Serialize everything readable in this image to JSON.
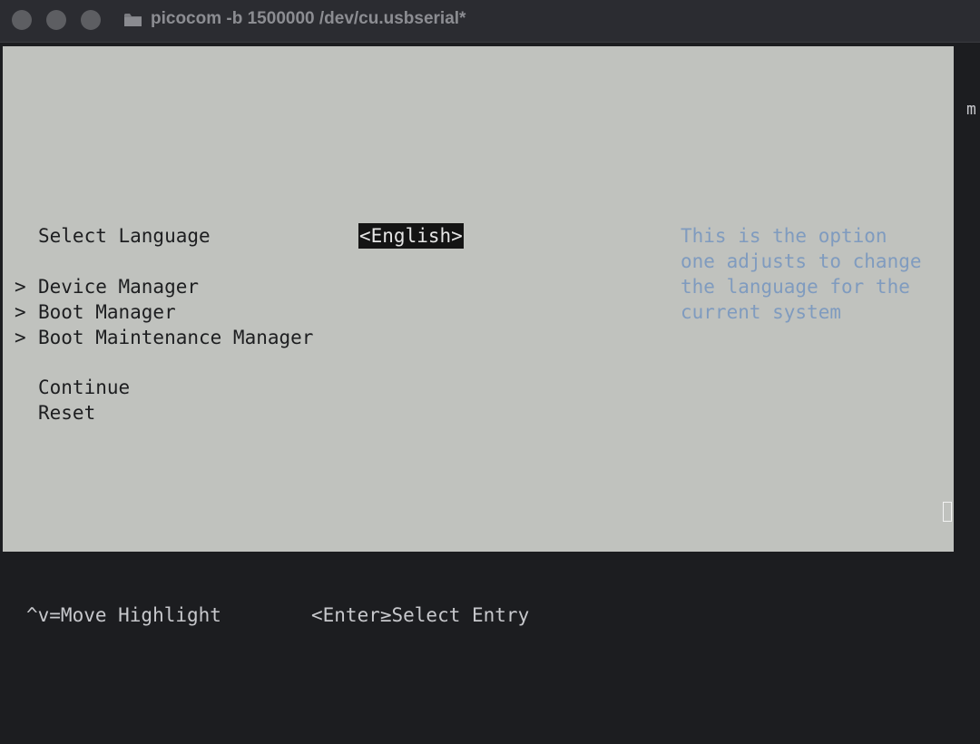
{
  "window": {
    "title": "picocom -b 1500000 /dev/cu.usbserial*"
  },
  "menu": {
    "language_label": "Select Language",
    "language_value": "<English>",
    "items": [
      {
        "marker": ">",
        "label": "Device Manager"
      },
      {
        "marker": ">",
        "label": "Boot Manager"
      },
      {
        "marker": ">",
        "label": "Boot Maintenance Manager"
      }
    ],
    "actions": [
      {
        "label": "Continue"
      },
      {
        "label": "Reset"
      }
    ]
  },
  "help": {
    "lines": [
      "This is the option",
      "one adjusts to change",
      "the language for the",
      "current system"
    ]
  },
  "footer": {
    "move_hint": "^v=Move Highlight",
    "select_hint": "<Enter≥Select Entry"
  },
  "stray": {
    "edge_text": "m"
  },
  "colors": {
    "bios_background": "#c0c2be",
    "help_text": "#7f9bbf",
    "terminal_background": "#1c1d20",
    "selection_background": "#141414"
  }
}
